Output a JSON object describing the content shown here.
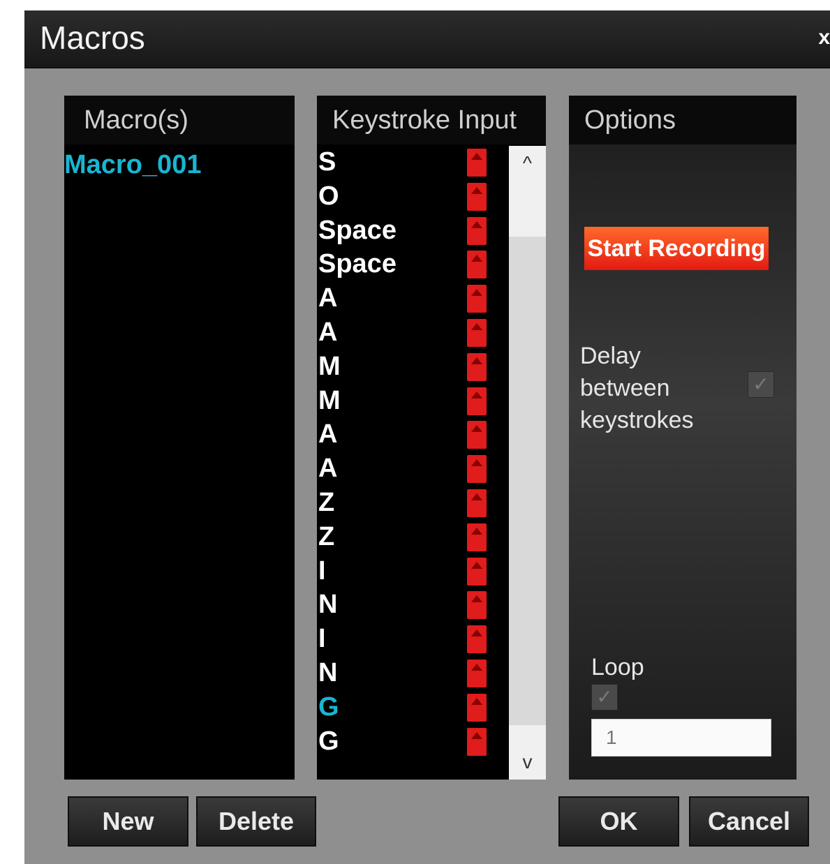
{
  "window": {
    "title": "Macros",
    "close_label": "x"
  },
  "macros": {
    "header": "Macro(s)",
    "items": [
      "Macro_001"
    ]
  },
  "keystrokes": {
    "header": "Keystroke Input",
    "items": [
      {
        "label": "S",
        "highlight": false
      },
      {
        "label": "O",
        "highlight": false
      },
      {
        "label": "Space",
        "highlight": false
      },
      {
        "label": "Space",
        "highlight": false
      },
      {
        "label": "A",
        "highlight": false
      },
      {
        "label": "A",
        "highlight": false
      },
      {
        "label": "M",
        "highlight": false
      },
      {
        "label": "M",
        "highlight": false
      },
      {
        "label": "A",
        "highlight": false
      },
      {
        "label": "A",
        "highlight": false
      },
      {
        "label": "Z",
        "highlight": false
      },
      {
        "label": "Z",
        "highlight": false
      },
      {
        "label": "I",
        "highlight": false
      },
      {
        "label": "N",
        "highlight": false
      },
      {
        "label": "I",
        "highlight": false
      },
      {
        "label": "N",
        "highlight": false
      },
      {
        "label": "G",
        "highlight": true
      },
      {
        "label": "G",
        "highlight": false
      }
    ],
    "scroll_up": "^",
    "scroll_down": "v"
  },
  "options": {
    "header": "Options",
    "record_button": "Start Recording",
    "delay_label": "Delay between keystrokes",
    "delay_checked": true,
    "loop_label": "Loop",
    "loop_checked": true,
    "loop_count": "1"
  },
  "buttons": {
    "new": "New",
    "delete": "Delete",
    "ok": "OK",
    "cancel": "Cancel"
  },
  "colors": {
    "accent": "#19b5d2",
    "record": "#e41a12",
    "arrow": "#e01c1c"
  }
}
